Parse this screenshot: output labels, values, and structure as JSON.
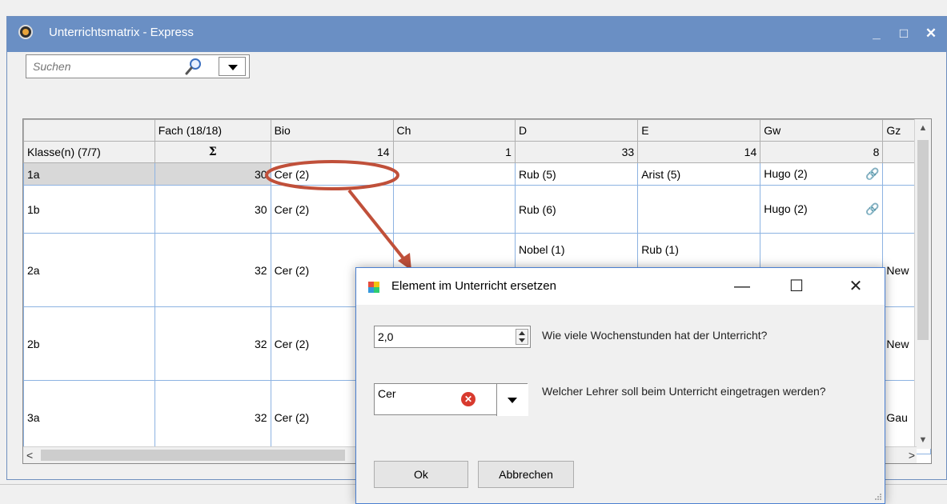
{
  "window": {
    "title": "Unterrichtsmatrix - Express",
    "min": "_",
    "max": "□",
    "close": "✕"
  },
  "search": {
    "placeholder": "Suchen"
  },
  "grid": {
    "header": [
      "",
      "Fach (18/18)",
      "Bio",
      "Ch",
      "D",
      "E",
      "Gw",
      "Gz"
    ],
    "sumrow": [
      "Klasse(n) (7/7)",
      "Σ",
      "14",
      "1",
      "33",
      "14",
      "8",
      ""
    ],
    "rows": [
      {
        "label": "1a",
        "total": "30",
        "bio": "Cer (2)",
        "ch": "",
        "d": "Rub (5)",
        "e": "Arist (5)",
        "gw": "Hugo (2)",
        "gz": ""
      },
      {
        "label": "1b",
        "total": "30",
        "bio": "Cer (2)",
        "ch": "",
        "d": "Rub (6)",
        "e": "",
        "gw": "Hugo (2)",
        "gz": ""
      },
      {
        "label": "2a",
        "total": "32",
        "bio": "Cer (2)",
        "ch": "",
        "d": "Nobel (1)",
        "e": "Rub (1)",
        "gw": "",
        "gz": "New"
      },
      {
        "label": "2b",
        "total": "32",
        "bio": "Cer (2)",
        "ch": "",
        "d": "",
        "e": "",
        "gw": "",
        "gz": "New"
      },
      {
        "label": "3a",
        "total": "32",
        "bio": "Cer (2)",
        "ch": "",
        "d": "",
        "e": "",
        "gw": "",
        "gz": "Gau"
      }
    ]
  },
  "dialog": {
    "title": "Element im Unterricht ersetzen",
    "hours_value": "2,0",
    "hours_question": "Wie viele Wochenstunden hat der Unterricht?",
    "teacher_value": "Cer",
    "teacher_question": "Welcher Lehrer soll beim Unterricht eingetragen werden?",
    "ok": "Ok",
    "cancel": "Abbrechen",
    "min": "—",
    "max": "☐",
    "close": "✕"
  },
  "colors": {
    "titlebar": "#6a8fc4",
    "annotation": "#c0503a",
    "grid_lines": "#8db3e2"
  }
}
